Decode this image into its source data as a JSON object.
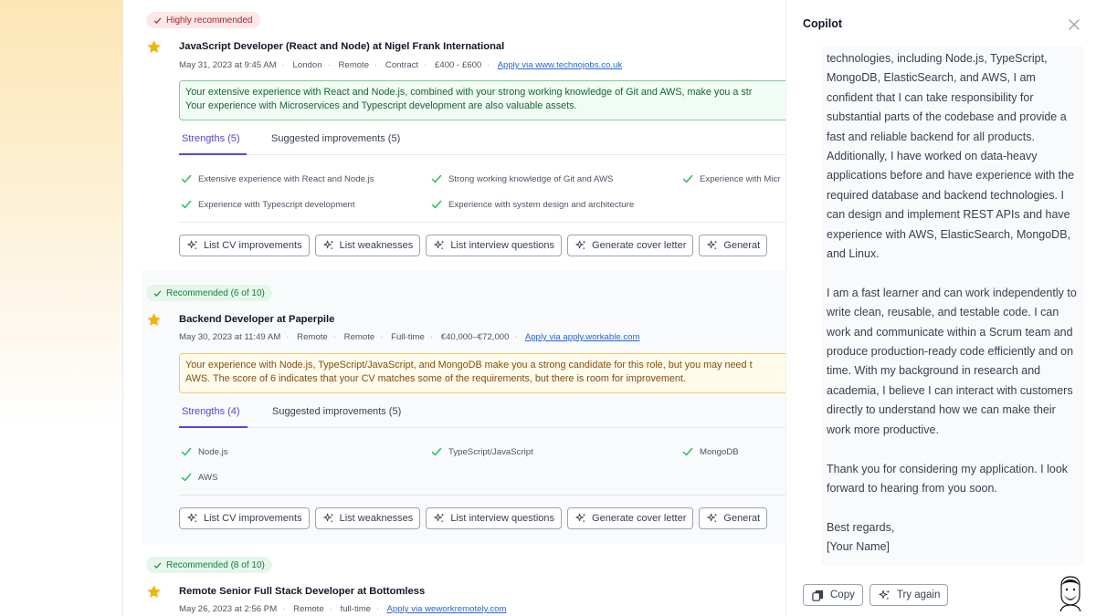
{
  "jobs": [
    {
      "badge": "Highly recommended",
      "title": "JavaScript Developer (React and Node) at Nigel Frank International",
      "meta": [
        "May 31, 2023 at 9:45 AM",
        "London",
        "Remote",
        "Contract",
        "£400 - £600"
      ],
      "apply": "Apply via www.technojobs.co.uk",
      "summary": [
        "Your extensive experience with React and Node.js, combined with your strong working knowledge of Git and AWS, make you a str",
        "Your experience with Microservices and Typescript development are also valuable assets."
      ],
      "tab_strengths": "Strengths (5)",
      "tab_improvements": "Suggested improvements (5)",
      "strengths": [
        "Extensive experience with React and Node.js",
        "Strong working knowledge of Git and AWS",
        "Experience with Micr",
        "Experience with Typescript development",
        "Experience with system design and architecture"
      ]
    },
    {
      "badge": "Recommended (6 of 10)",
      "title": "Backend Developer at Paperpile",
      "meta": [
        "May 30, 2023 at 11:49 AM",
        "Remote",
        "Remote",
        "Full-time",
        "€40,000–€72,000"
      ],
      "apply": "Apply via apply.workable.com",
      "summary": [
        "Your experience with Node.js, TypeScript/JavaScript, and MongoDB make you a strong candidate for this role, but you may need t",
        "AWS. The score of 6 indicates that your CV matches some of the requirements, but there is room for improvement."
      ],
      "tab_strengths": "Strengths (4)",
      "tab_improvements": "Suggested improvements (5)",
      "strengths": [
        "Node.js",
        "TypeScript/JavaScript",
        "MongoDB",
        "AWS"
      ]
    },
    {
      "badge": "Recommended (8 of 10)",
      "title": "Remote Senior Full Stack Developer at Bottomless",
      "meta": [
        "May 26, 2023 at 2:56 PM",
        "Remote",
        "full-time"
      ],
      "apply": "Apply via weworkremotely.com"
    }
  ],
  "actions": [
    "List CV improvements",
    "List weaknesses",
    "List interview questions",
    "Generate cover letter",
    "Generat"
  ],
  "copilot": {
    "title": "Copilot",
    "paragraphs": [
      "technologies, including Node.js, TypeScript, MongoDB, ElasticSearch, and AWS, I am confident that I can take responsibility for substantial parts of the codebase and provide a fast and reliable backend for all products. Additionally, I have worked on data-heavy applications before and have experience with the required database and backend technologies. I can design and implement REST APIs and have experience with AWS, ElasticSearch, MongoDB, and Linux.",
      "I am a fast learner and can work independently to write clean, reusable, and testable code. I can work and communicate within a Scrum team and produce production-ready code efficiently and on time. With my background in research and academia, I believe I can interact with customers directly to understand how we can make their work more productive.",
      "Thank you for considering my application. I look forward to hearing from you soon.",
      "Best regards,",
      "[Your Name]"
    ],
    "copy_label": "Copy",
    "retry_label": "Try again"
  },
  "icons": {
    "star": "star-icon",
    "check": "check-icon",
    "sparkle": "sparkle-icon",
    "close": "close-icon",
    "copy": "copy-icon"
  },
  "colors": {
    "accent": "#4f46e5",
    "star": "#f5b301",
    "check": "#22c55e"
  }
}
